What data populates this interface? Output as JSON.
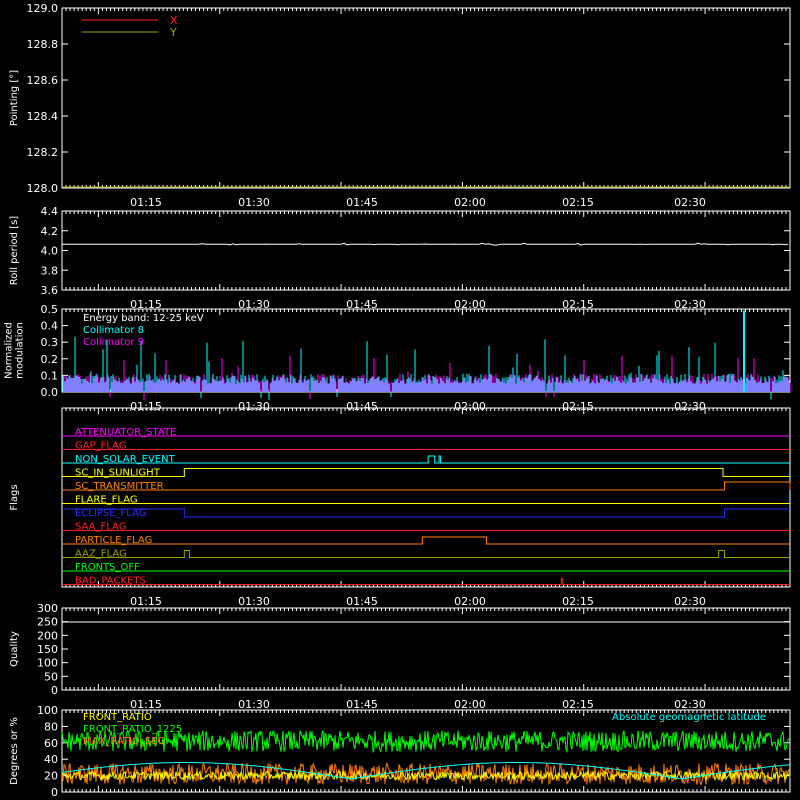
{
  "time_ticks": [
    "01:15",
    "01:30",
    "01:45",
    "02:00",
    "02:15",
    "02:30"
  ],
  "colors": {
    "background": "#000000",
    "axis": "#ffffff",
    "x": "#ff2020",
    "y": "#a0a000",
    "cyan": "#00ffff",
    "magenta": "#ff00ff",
    "green": "#00ff00",
    "orange": "#ff8000",
    "yellow": "#ffff00"
  },
  "chart_data": [
    {
      "id": "pointing",
      "type": "line",
      "ylabel": "Pointing [°]",
      "ylim": [
        128.0,
        129.0
      ],
      "yticks": [
        "129.0",
        "128.8",
        "128.6",
        "128.4",
        "128.2",
        "128.0"
      ],
      "series": [
        {
          "name": "X",
          "color": "#ff2020",
          "values": []
        },
        {
          "name": "Y",
          "color": "#a0a000",
          "values": []
        }
      ],
      "legend_position": "top-left"
    },
    {
      "id": "roll",
      "type": "line",
      "ylabel": "Roll period [s]",
      "ylim": [
        3.5,
        4.5
      ],
      "yticks": [
        "4.4",
        "4.2",
        "4.0",
        "3.8",
        "3.6"
      ],
      "series": [
        {
          "color": "#ffffff",
          "constant": 4.08
        }
      ]
    },
    {
      "id": "modulation",
      "type": "bar",
      "ylabel": "Normalized modulation",
      "ylabel_lines": [
        "Normalized",
        "modulation"
      ],
      "ylim": [
        0.0,
        0.5
      ],
      "yticks": [
        "0.5",
        "0.4",
        "0.3",
        "0.2",
        "0.1",
        "0.0"
      ],
      "annotation": "Energy band: 12-25 keV",
      "series": [
        {
          "name": "Collimator 8",
          "color": "#00ffff",
          "typical": 0.1,
          "peak": 0.49
        },
        {
          "name": "Collimator 9",
          "color": "#ff00ff",
          "typical": 0.1,
          "peak": 0.3
        }
      ]
    },
    {
      "id": "flags",
      "type": "line",
      "ylabel": "Flags",
      "flags": [
        {
          "name": "ATTENUATOR_STATE",
          "color": "#ff00ff"
        },
        {
          "name": "GAP_FLAG",
          "color": "#ff2020"
        },
        {
          "name": "NON_SOLAR_EVENT",
          "color": "#00ffff"
        },
        {
          "name": "SC_IN_SUNLIGHT",
          "color": "#ffff00"
        },
        {
          "name": "SC_TRANSMITTER",
          "color": "#ff8000"
        },
        {
          "name": "FLARE_FLAG",
          "color": "#ffff00"
        },
        {
          "name": "ECLIPSE_FLAG",
          "color": "#2030ff"
        },
        {
          "name": "SAA_FLAG",
          "color": "#ff2020"
        },
        {
          "name": "PARTICLE_FLAG",
          "color": "#ff8000"
        },
        {
          "name": "AAZ_FLAG",
          "color": "#a0a000"
        },
        {
          "name": "FRONTS_OFF",
          "color": "#00ff00"
        },
        {
          "name": "BAD_PACKETS",
          "color": "#ff2020"
        }
      ]
    },
    {
      "id": "quality",
      "type": "line",
      "ylabel": "Quality",
      "ylim": [
        0,
        300
      ],
      "yticks": [
        "300",
        "250",
        "200",
        "150",
        "100",
        "50",
        "0"
      ],
      "series": [
        {
          "color": "#ffffff",
          "constant": 300
        }
      ]
    },
    {
      "id": "ratio",
      "type": "line",
      "ylabel": "Degrees or %",
      "ylim": [
        0,
        100
      ],
      "yticks": [
        "100",
        "80",
        "60",
        "40",
        "20",
        "0"
      ],
      "series": [
        {
          "name": "FRONT_RATIO",
          "color": "#ffff00",
          "typical": 20
        },
        {
          "name": "FRONT_RATIO_1225",
          "color": "#00ff00",
          "typical": 62
        },
        {
          "name": "MAX_RATIO_SEG",
          "color": "#ff8000",
          "typical": 22
        },
        {
          "name": "Absolute geomagnetic latitude",
          "color": "#00ffff"
        }
      ]
    }
  ]
}
